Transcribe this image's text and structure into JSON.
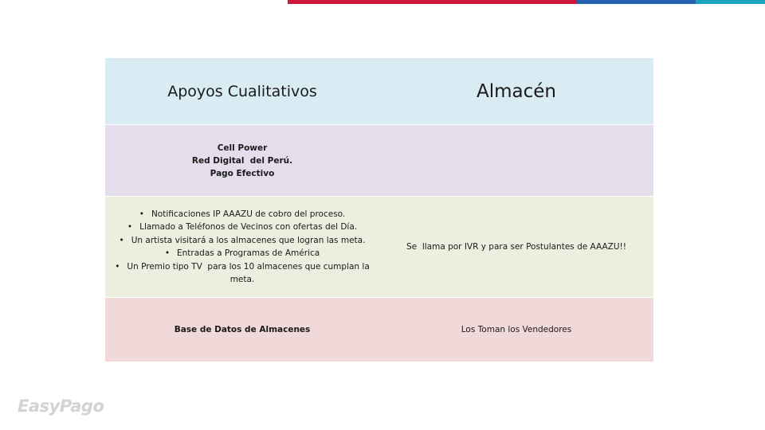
{
  "colors": {
    "bar_red": "#d0173a",
    "bar_blue": "#2462b0",
    "bar_teal": "#1aa4bf",
    "header_bg": "#d9ecf3",
    "row1_bg": "#e4deec",
    "row2_bg": "#ebefdf",
    "row3_bg": "#f1d8d9"
  },
  "table": {
    "headers": {
      "left": "Apoyos Cualitativos",
      "right": "Almacén"
    },
    "row1": {
      "left_lines": [
        "Cell Power",
        "Red Digital  del Perú.",
        "Pago Efectivo"
      ],
      "right": ""
    },
    "row2": {
      "left_bullets": [
        "Notificaciones IP AAAZU de cobro del proceso.",
        "Llamado a Teléfonos de Vecinos con ofertas del Día.",
        "Un artista visitará a los almacenes que logran las meta.",
        "Entradas a Programas de América",
        "Un Premio tipo TV  para los 10 almacenes que cumplan la meta."
      ],
      "right": "Se  llama por IVR y para ser Postulantes de AAAZU!!"
    },
    "row3": {
      "left": "Base de Datos de Almacenes",
      "right": "Los Toman los Vendedores"
    }
  },
  "logo": {
    "text": "EasyPago"
  }
}
